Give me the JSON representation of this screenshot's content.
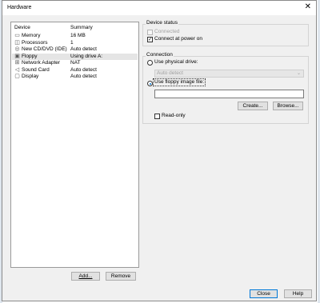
{
  "window": {
    "title": "Hardware"
  },
  "device_list": {
    "headers": {
      "device": "Device",
      "summary": "Summary"
    },
    "rows": [
      {
        "name": "Memory",
        "summary": "16 MB",
        "icon": "memory-icon",
        "glyph": "▭"
      },
      {
        "name": "Processors",
        "summary": "1",
        "icon": "processor-icon",
        "glyph": "◫"
      },
      {
        "name": "New CD/DVD (IDE)",
        "summary": "Auto detect",
        "icon": "cd-dvd-icon",
        "glyph": "◎"
      },
      {
        "name": "Floppy",
        "summary": "Using drive A:",
        "icon": "floppy-icon",
        "glyph": "▣",
        "selected": true
      },
      {
        "name": "Network Adapter",
        "summary": "NAT",
        "icon": "network-adapter-icon",
        "glyph": "⊞"
      },
      {
        "name": "Sound Card",
        "summary": "Auto detect",
        "icon": "sound-card-icon",
        "glyph": "◁"
      },
      {
        "name": "Display",
        "summary": "Auto detect",
        "icon": "display-icon",
        "glyph": "▢"
      }
    ],
    "add_button": "Add...",
    "remove_button": "Remove"
  },
  "device_status": {
    "label": "Device status",
    "connected": {
      "label": "Connected",
      "checked": false,
      "disabled": true
    },
    "connect_at_power_on": {
      "label": "Connect at power on",
      "checked": true
    }
  },
  "connection": {
    "label": "Connection",
    "use_physical_drive": {
      "label": "Use physical drive:",
      "selected": false
    },
    "physical_drive_select": {
      "value": "Auto detect"
    },
    "use_floppy_image": {
      "label": "Use floppy image file:",
      "selected": true
    },
    "image_path": {
      "value": ""
    },
    "create_button": "Create...",
    "browse_button": "Browse...",
    "read_only": {
      "label": "Read-only",
      "checked": false
    }
  },
  "footer": {
    "close_button": "Close",
    "help_button": "Help"
  }
}
